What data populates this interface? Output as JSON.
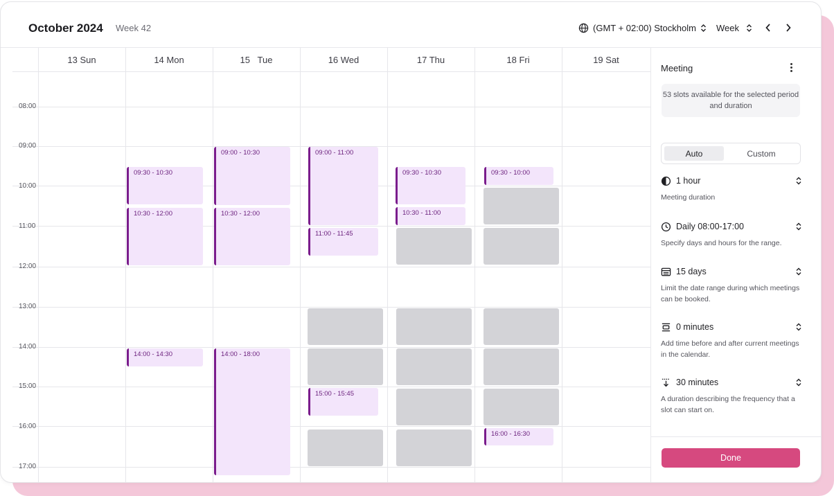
{
  "header": {
    "title": "October 2024",
    "week": "Week 42",
    "timezone": "(GMT + 02:00) Stockholm",
    "view": "Week"
  },
  "days": [
    "13 Sun",
    "14 Mon",
    "15   Tue",
    "16 Wed",
    "17 Thu",
    "18 Fri",
    "19 Sat"
  ],
  "times": [
    "08:00",
    "09:00",
    "10:00",
    "11:00",
    "12:00",
    "13:00",
    "14:00",
    "15:00",
    "16:00",
    "17:00"
  ],
  "events": [
    {
      "day": 1,
      "label": "09:30 - 10:30"
    },
    {
      "day": 1,
      "label": "10:30 - 12:00"
    },
    {
      "day": 1,
      "label": "14:00 - 14:30"
    },
    {
      "day": 2,
      "label": "09:00 - 10:30"
    },
    {
      "day": 2,
      "label": "10:30 - 12:00"
    },
    {
      "day": 2,
      "label": "14:00 - 18:00"
    },
    {
      "day": 3,
      "label": "09:00 - 11:00"
    },
    {
      "day": 3,
      "label": "11:00 - 11:45"
    },
    {
      "day": 3,
      "label": "15:00 - 15:45"
    },
    {
      "day": 4,
      "label": "09:30 - 10:30"
    },
    {
      "day": 4,
      "label": "10:30 - 11:00"
    },
    {
      "day": 5,
      "label": "09:30 - 10:00"
    },
    {
      "day": 5,
      "label": "16:00 - 16:30"
    }
  ],
  "panel": {
    "title": "Meeting",
    "slots_text": "53 slots available for the selected period and duration",
    "mode_auto": "Auto",
    "mode_custom": "Custom",
    "duration": {
      "value": "1 hour",
      "desc": "Meeting duration",
      "icon": "half-circle-icon"
    },
    "hours": {
      "value": "Daily 08:00-17:00",
      "desc": "Specify days and hours for the range.",
      "icon": "clock-icon"
    },
    "range": {
      "value": "15 days",
      "desc": "Limit the date range during which meetings can be booked.",
      "icon": "calendar-range-icon"
    },
    "buffer": {
      "value": "0 minutes",
      "desc": "Add time before and after current meetings in the calendar.",
      "icon": "buffer-icon"
    },
    "frequency": {
      "value": "30 minutes",
      "desc": "A duration describing the frequency that a slot can start on.",
      "icon": "frequency-icon"
    },
    "done": "Done"
  },
  "colors": {
    "accent": "#d6497f",
    "event_bg": "#f3e5fb",
    "event_border": "#7a1c8c",
    "busy": "#d3d3d7",
    "backdrop": "#f4c7d9"
  }
}
